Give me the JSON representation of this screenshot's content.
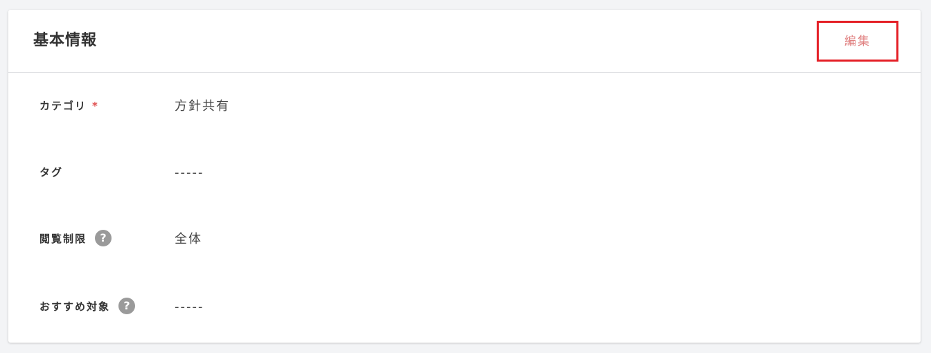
{
  "panel": {
    "title": "基本情報",
    "edit_label": "編集"
  },
  "fields": [
    {
      "label": "カテゴリ",
      "required_mark": "*",
      "value": "方針共有"
    },
    {
      "label": "タグ",
      "value": "-----"
    },
    {
      "label": "閲覧制限",
      "help_icon": "?",
      "value": "全体"
    },
    {
      "label": "おすすめ対象",
      "help_icon": "?",
      "value": "-----"
    }
  ],
  "colors": {
    "accent_red": "#e41f26",
    "edit_text": "#e08080",
    "required": "#e05050",
    "help_icon_bg": "#9a9a9a"
  }
}
